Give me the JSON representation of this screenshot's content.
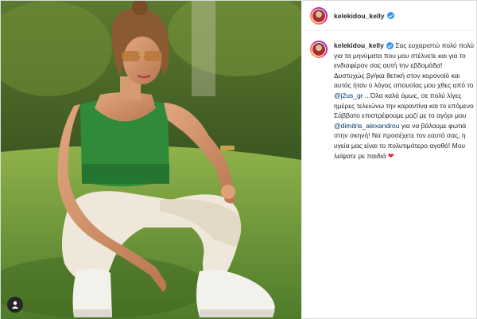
{
  "post": {
    "username": "kelekidou_kelly",
    "verified": true,
    "caption": {
      "part1": "Σας ευχαριστώ πολύ πολύ για τα μηνύματα που μου στέλνετε και για το ενδιαφέρον σας αυτή την εβδομάδα! Δυστυχώς βγήκα θετική στον κορονοϊό και αυτός ήταν ο λόγος απουσίας μου χθες από το",
      "mention1": "@j2us_gr",
      "part2": "...Όλα καλά όμως, σε πολύ λίγες ημέρες τελειώνω την καραντίνα και το επόμενο Σάββατο επιστρέφουμε μαζί με το αγόρι μου",
      "mention2": "@dimitris_alexandrou",
      "part3": "για να βάλουμε φωτιά στην σκηνή! Να προσέχετε τον εαυτό σας, η υγεία μας είναι το πολυτιμότερο αγαθό! Μου λείψατε ρε παιδιά",
      "emoji": "❤"
    }
  },
  "icons": {
    "tag": "user-tag-icon",
    "verified": "verified-badge-icon",
    "heart": "red-heart-icon"
  },
  "colors": {
    "verified": "#3897f0",
    "mention": "#00376b",
    "heart": "#e0243b"
  }
}
